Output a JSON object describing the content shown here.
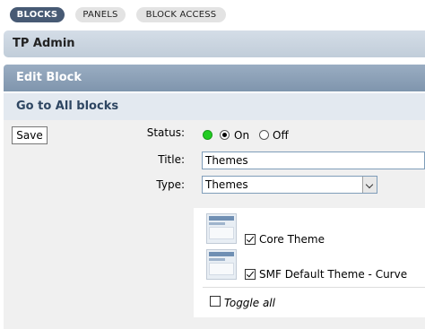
{
  "tabs": [
    {
      "label": "BLOCKS",
      "active": true
    },
    {
      "label": "PANELS",
      "active": false
    },
    {
      "label": "BLOCK ACCESS",
      "active": false
    }
  ],
  "header": {
    "title": "TP Admin"
  },
  "section": {
    "title": "Edit Block",
    "goto_link": "Go to All blocks"
  },
  "form": {
    "save_label": "Save",
    "status_label": "Status:",
    "status_on": "On",
    "status_off": "Off",
    "status_value": "On",
    "title_label": "Title:",
    "title_value": "Themes",
    "type_label": "Type:",
    "type_value": "Themes"
  },
  "themes": [
    {
      "name": "Core Theme",
      "checked": true
    },
    {
      "name": "SMF Default Theme - Curve",
      "checked": true
    }
  ],
  "toggle_all_label": "Toggle all",
  "colors": {
    "accent": "#475a74",
    "status_green": "#22cc22",
    "section_header": "#8ea2b9",
    "link": "#2e4662"
  }
}
